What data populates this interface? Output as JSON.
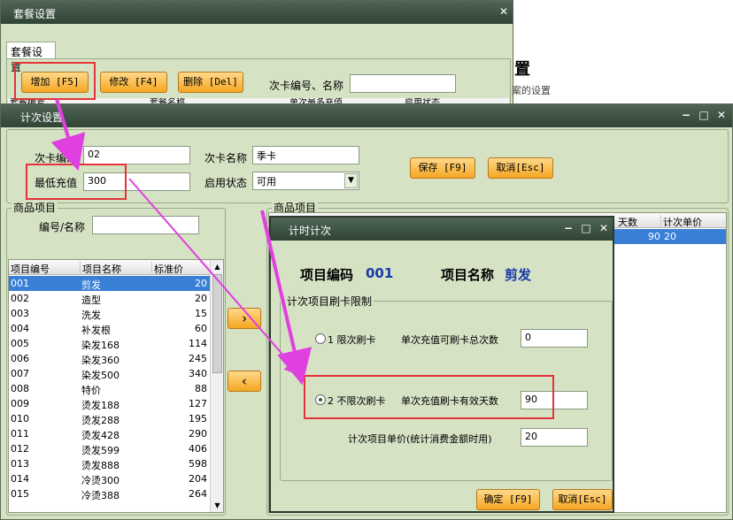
{
  "bg_window": {
    "title": "套餐设置",
    "tab": "套餐设置",
    "add_btn": "增加 [F5]",
    "edit_btn": "修改 [F4]",
    "delete_btn": "删除 [Del]",
    "search_label": "次卡编号、名称",
    "search_value": "",
    "col1": "套餐编号",
    "col2": "套餐名称",
    "col3": "单次最多充值",
    "col4": "启用状态"
  },
  "side_text": {
    "big": "置",
    "small": "案的设置"
  },
  "count_window": {
    "title": "计次设置",
    "card_no_label": "次卡编码",
    "card_no_value": "02",
    "card_name_label": "次卡名称",
    "card_name_value": "季卡",
    "min_recharge_label": "最低充值",
    "min_recharge_value": "300",
    "status_label": "启用状态",
    "status_value": "可用",
    "save_btn": "保存 [F9]",
    "cancel_btn": "取消[Esc]",
    "goods_group": "商品项目",
    "code_name_label": "编号/名称",
    "code_name_value": "",
    "goods_headers": [
      "项目编号",
      "项目名称",
      "标准价"
    ],
    "goods_rows": [
      [
        "001",
        "剪发",
        "20"
      ],
      [
        "002",
        "造型",
        "20"
      ],
      [
        "003",
        "洗发",
        "15"
      ],
      [
        "004",
        "补发根",
        "60"
      ],
      [
        "005",
        "染发168",
        "114"
      ],
      [
        "006",
        "染发360",
        "245"
      ],
      [
        "007",
        "染发500",
        "340"
      ],
      [
        "008",
        "特价",
        "88"
      ],
      [
        "009",
        "烫发188",
        "127"
      ],
      [
        "010",
        "烫发288",
        "195"
      ],
      [
        "011",
        "烫发428",
        "290"
      ],
      [
        "012",
        "烫发599",
        "406"
      ],
      [
        "013",
        "烫发888",
        "598"
      ],
      [
        "014",
        "冷烫300",
        "204"
      ],
      [
        "015",
        "冷烫388",
        "264"
      ]
    ],
    "move_right": "›",
    "move_left": "‹",
    "right_group": "商品项目",
    "right_headers": [
      "天数",
      "计次单价"
    ],
    "right_row": [
      "90",
      "20"
    ]
  },
  "timer_window": {
    "title": "计时计次",
    "item_code_label": "项目编码",
    "item_code_value": "001",
    "item_name_label": "项目名称",
    "item_name_value": "剪发",
    "limit_group": "计次项目刷卡限制",
    "opt1_label": "1  限次刷卡",
    "opt1_desc": "单次充值可刷卡总次数",
    "opt1_value": "0",
    "opt2_label": "2  不限次刷卡",
    "opt2_desc": "单次充值刷卡有效天数",
    "opt2_value": "90",
    "unit_price_label": "计次项目单价(统计消费金额时用)",
    "unit_price_value": "20",
    "ok_btn": "确定 [F9]",
    "cancel_btn": "取消[Esc]"
  },
  "colors": {
    "highlight": "#e4333a",
    "arrow": "#e040e0",
    "accent": "#f5a623",
    "select": "#3a7fd6"
  }
}
